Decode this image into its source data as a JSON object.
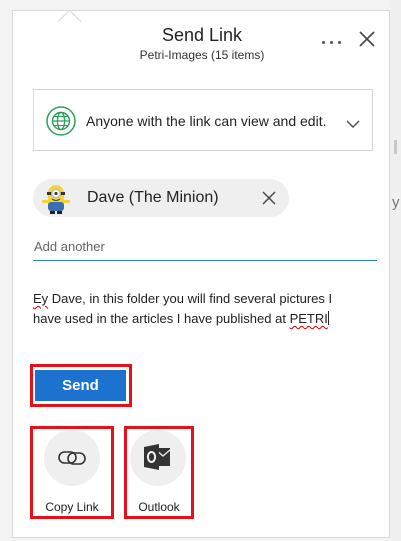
{
  "dialog": {
    "title": "Send Link",
    "subtitle": "Petri-Images (15 items)",
    "more_icon": "more-horizontal-icon",
    "close_icon": "close-icon"
  },
  "permission": {
    "icon": "globe-icon",
    "text": "Anyone with the link can view and edit."
  },
  "recipients": [
    {
      "name": "Dave (The Minion)",
      "avatar": "minion-avatar"
    }
  ],
  "add_input": {
    "placeholder": "Add another",
    "value": ""
  },
  "message": {
    "line1_word1": "Ey",
    "line1_rest": " Dave, in this folder you will find several pictures I",
    "line2_start": "have used in the articles I have published at ",
    "line2_word": "PETRI"
  },
  "send_button": {
    "label": "Send"
  },
  "share_options": [
    {
      "label": "Copy Link",
      "icon": "link-icon"
    },
    {
      "label": "Outlook",
      "icon": "outlook-icon"
    }
  ],
  "colors": {
    "accent": "#1d72cf",
    "highlight": "#e3111c",
    "globe": "#2e9e5b"
  }
}
